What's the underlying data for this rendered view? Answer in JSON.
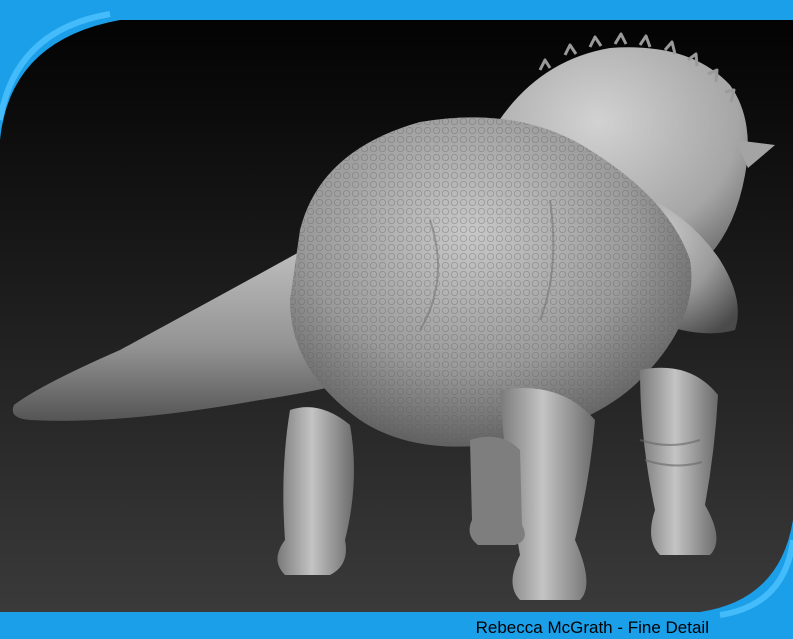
{
  "caption": "Rebecca McGrath - Fine Detail",
  "colors": {
    "frame_blue": "#1a9fe8",
    "frame_blue_light": "#4fc3ff",
    "background_top": "#030303",
    "background_bottom": "#3a3a3a",
    "sculpt_light": "#c9c9c9",
    "sculpt_mid": "#8f8f8f",
    "sculpt_dark": "#3e3e3e",
    "caption_text": "#000000"
  },
  "image": {
    "subject": "triceratops-sculpt"
  }
}
